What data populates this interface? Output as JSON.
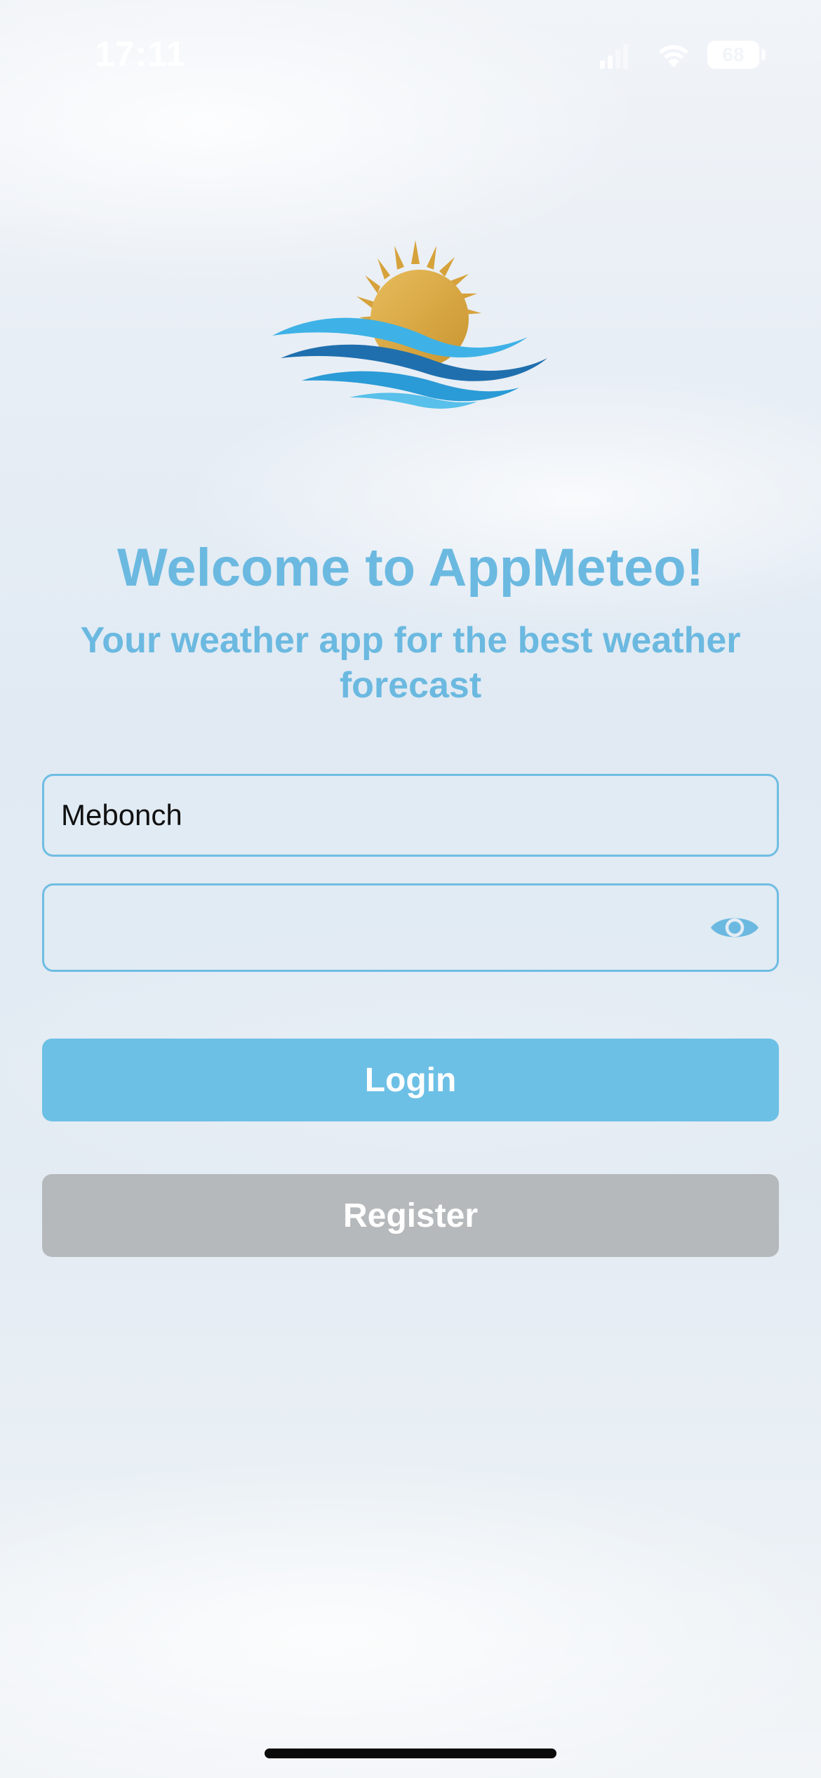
{
  "status_bar": {
    "time": "17:11",
    "battery": "68"
  },
  "logo": {
    "icon": "sun-over-waves-logo",
    "colors": {
      "sun": "#d9a640",
      "wave_light": "#3fb3e6",
      "wave_dark": "#1f74b4"
    }
  },
  "header": {
    "title": "Welcome to AppMeteo!",
    "subtitle": "Your weather app for the best weather forecast"
  },
  "form": {
    "username_value": "Mebonch",
    "password_value": "",
    "password_toggle_icon": "eye-icon"
  },
  "actions": {
    "login_label": "Login",
    "register_label": "Register"
  },
  "colors": {
    "accent": "#6bb9e0",
    "login_button": "#6dc0e5",
    "register_button": "#b6b9bb"
  }
}
